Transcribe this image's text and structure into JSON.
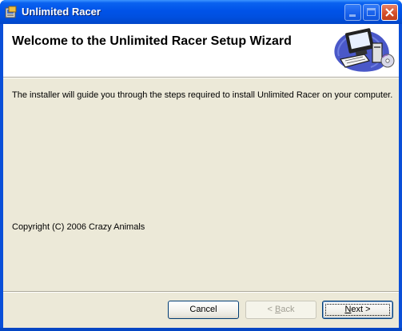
{
  "window": {
    "title": "Unlimited Racer",
    "controls": {
      "minimize_icon": "minimize-icon",
      "maximize_icon": "maximize-icon",
      "close_icon": "close-icon"
    }
  },
  "banner": {
    "title": "Welcome to the Unlimited Racer Setup Wizard",
    "art_icon": "computer-setup-icon"
  },
  "body": {
    "description": "The installer will guide you through the steps required to install Unlimited Racer on your computer.",
    "copyright": "Copyright (C) 2006 Crazy Animals"
  },
  "buttons": {
    "cancel": "Cancel",
    "back": {
      "mnemonic": "B",
      "rest": "ack",
      "arrow": "< "
    },
    "next": {
      "mnemonic": "N",
      "rest": "ext",
      "arrow": " >"
    }
  },
  "colors": {
    "titlebar": "#0053e8",
    "dialog_face": "#ece9d8",
    "close_button": "#d6502a"
  }
}
